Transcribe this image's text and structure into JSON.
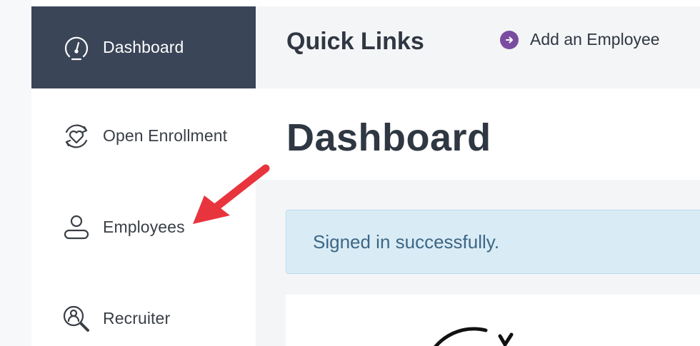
{
  "sidebar": {
    "items": [
      {
        "label": "Dashboard",
        "icon": "gauge-icon",
        "active": true
      },
      {
        "label": "Open Enrollment",
        "icon": "heart-cycle-icon",
        "active": false
      },
      {
        "label": "Employees",
        "icon": "person-icon",
        "active": false
      },
      {
        "label": "Recruiter",
        "icon": "person-search-icon",
        "active": false
      }
    ]
  },
  "header": {
    "title": "Quick Links",
    "links": [
      {
        "label": "Add an Employee",
        "icon": "arrow-circle-right-icon"
      }
    ]
  },
  "main": {
    "title": "Dashboard",
    "alert": "Signed in successfully."
  },
  "annotation": {
    "icon": "red-pointer-arrow-icon",
    "color": "#e8353d"
  },
  "colors": {
    "sidebar_active": "#3a4557",
    "accent_purple": "#7a4ca0",
    "alert_bg": "#d9ecf6",
    "alert_text": "#3d6685"
  }
}
